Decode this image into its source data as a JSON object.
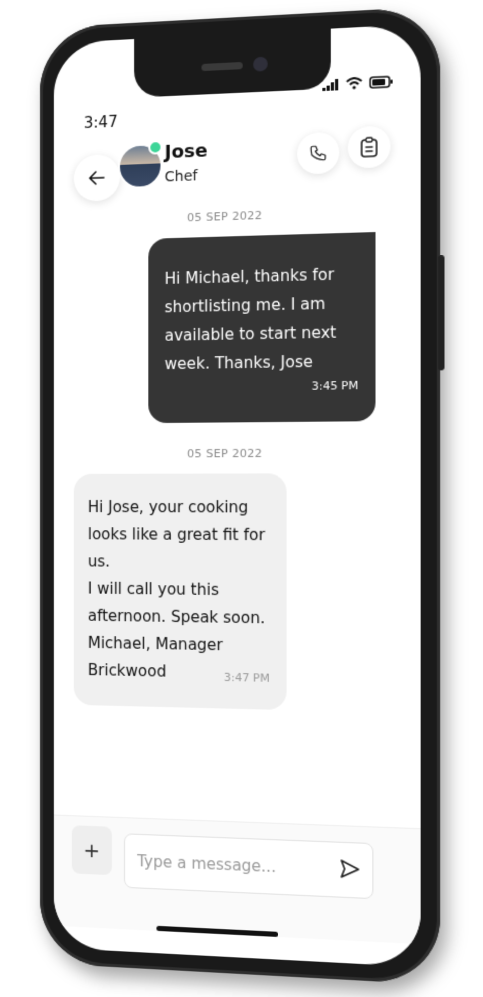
{
  "status_bar": {
    "time": "3:47",
    "icons": [
      "signal-icon",
      "wifi-icon",
      "battery-icon"
    ]
  },
  "header": {
    "back_icon": "arrow-left-icon",
    "contact_name": "Jose",
    "contact_role": "Chef",
    "online": true,
    "actions": [
      "phone-icon",
      "clipboard-icon"
    ]
  },
  "messages": [
    {
      "date": "05 SEP 2022",
      "direction": "outgoing",
      "lines": [
        "Hi Michael, thanks for",
        "shortlisting me. I am",
        "available to start next",
        "week. Thanks, Jose"
      ],
      "time": "3:45 PM"
    },
    {
      "date": "05 SEP 2022",
      "direction": "incoming",
      "lines": [
        "Hi Jose, your cooking",
        "looks like a great fit for us.",
        "I will call you this",
        "afternoon.  Speak soon.",
        "Michael, Manager",
        "Brickwood"
      ],
      "time": "3:47 PM"
    }
  ],
  "composer": {
    "plus_label": "+",
    "placeholder": "Type a message...",
    "value": "",
    "send_icon": "send-icon"
  },
  "colors": {
    "outgoing_bubble": "#353535",
    "incoming_bubble": "#f0f0f0",
    "online_dot": "#3dd598",
    "phone_frame": "#1a1a1a"
  }
}
